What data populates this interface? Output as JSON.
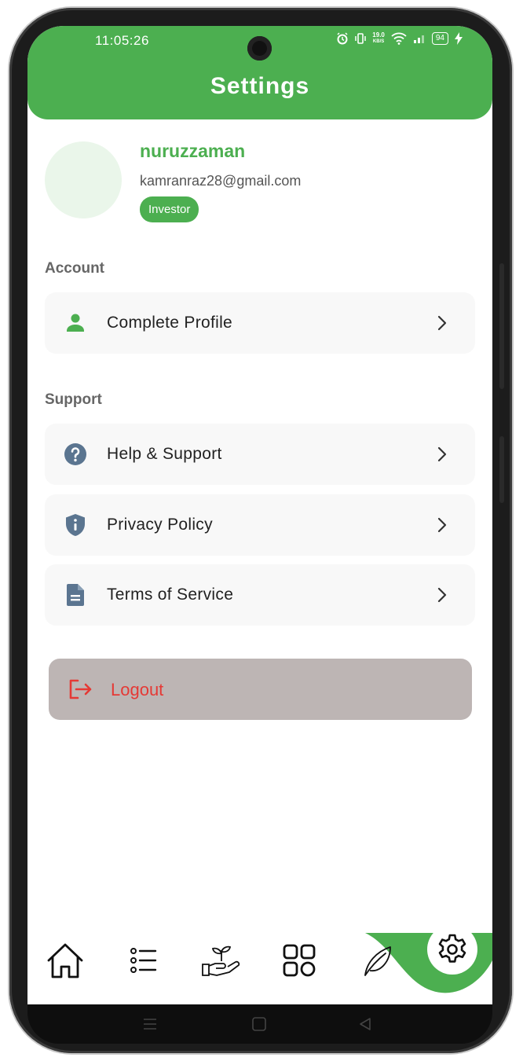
{
  "status_bar": {
    "time": "11:05:26",
    "net_speed_value": "19.0",
    "net_speed_unit": "KB/S",
    "battery": "94"
  },
  "header": {
    "title": "Settings"
  },
  "profile": {
    "name": "nuruzzaman",
    "email": "kamranraz28@gmail.com",
    "role": "Investor"
  },
  "sections": {
    "account": {
      "title": "Account",
      "items": [
        {
          "label": "Complete Profile",
          "icon": "person-icon"
        }
      ]
    },
    "support": {
      "title": "Support",
      "items": [
        {
          "label": "Help & Support",
          "icon": "help-circle-icon"
        },
        {
          "label": "Privacy Policy",
          "icon": "shield-info-icon"
        },
        {
          "label": "Terms of Service",
          "icon": "document-icon"
        }
      ]
    }
  },
  "logout": {
    "label": "Logout",
    "icon": "logout-icon"
  },
  "bottom_nav": {
    "items": [
      {
        "icon": "home-icon"
      },
      {
        "icon": "list-icon"
      },
      {
        "icon": "hand-plant-icon"
      },
      {
        "icon": "grid-icon"
      },
      {
        "icon": "leaf-icon"
      },
      {
        "icon": "gear-icon",
        "active": true
      }
    ]
  },
  "colors": {
    "brand": "#4caf50",
    "danger": "#e53935",
    "icon_slate": "#5b7590",
    "logout_bg": "#bdb5b4"
  }
}
